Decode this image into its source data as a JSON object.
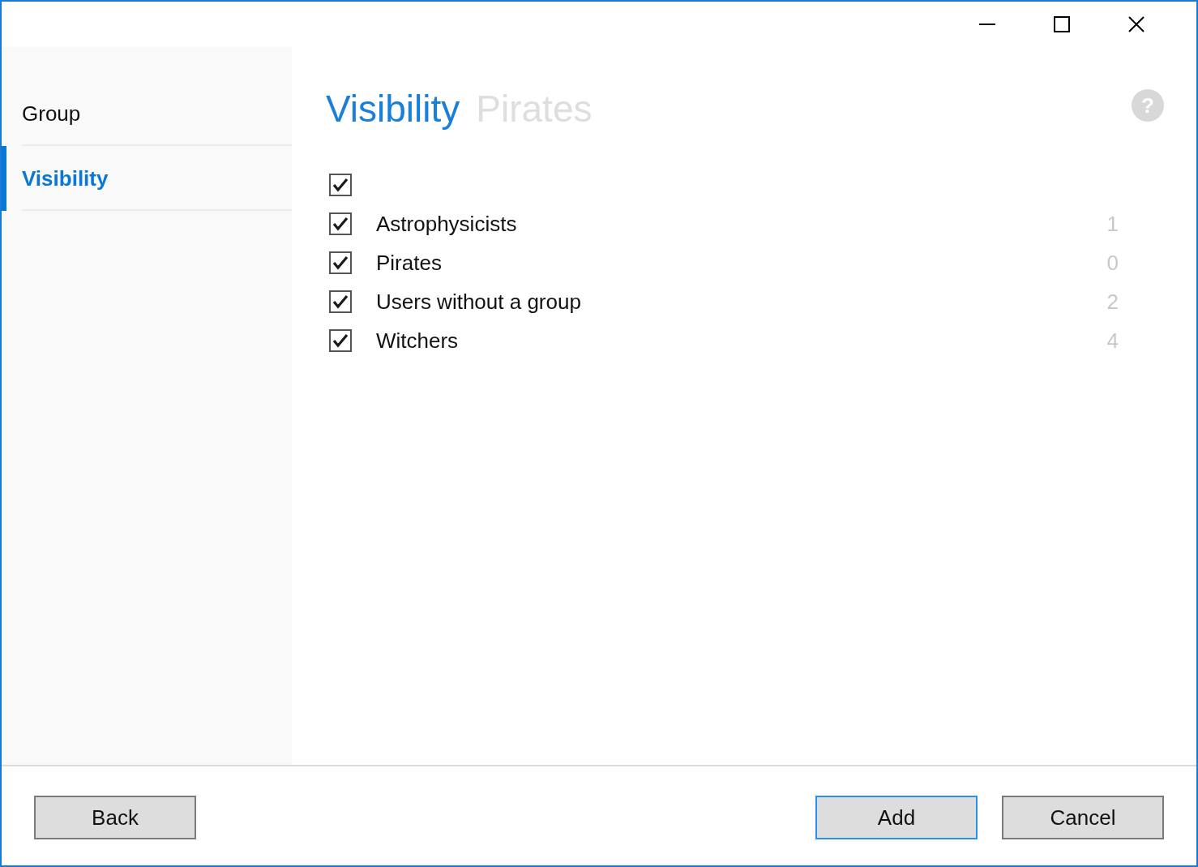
{
  "window": {
    "controls": [
      {
        "kind": "minimize"
      },
      {
        "kind": "maximize"
      },
      {
        "kind": "close"
      }
    ]
  },
  "sidebar": {
    "items": [
      {
        "label": "Group",
        "selected": false
      },
      {
        "label": "Visibility",
        "selected": true
      }
    ]
  },
  "header": {
    "title": "Visibility",
    "subtitle": "Pirates",
    "help": "?"
  },
  "list": [
    {
      "checked": true
    },
    {
      "label": "Astrophysicists",
      "count": "1",
      "checked": true
    },
    {
      "label": "Pirates",
      "count": "0",
      "checked": true
    },
    {
      "label": "Users without a group",
      "count": "2",
      "checked": true
    },
    {
      "label": "Witchers",
      "count": "4",
      "checked": true
    }
  ],
  "buttons": [
    {
      "label": "Back",
      "focused": false
    },
    {
      "label": "Add",
      "focused": true
    },
    {
      "label": "Cancel",
      "focused": false
    }
  ]
}
